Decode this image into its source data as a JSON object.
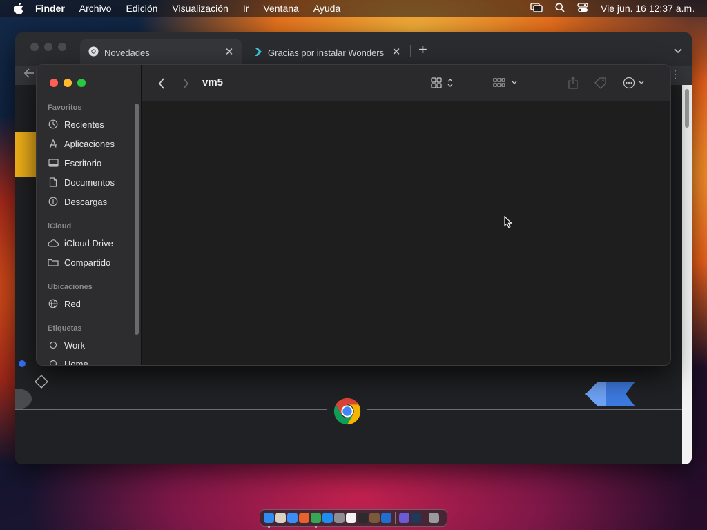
{
  "menubar": {
    "app_name": "Finder",
    "items": [
      "Archivo",
      "Edición",
      "Visualización",
      "Ir",
      "Ventana",
      "Ayuda"
    ],
    "clock": "Vie jun. 16  12:37 a.m."
  },
  "browser": {
    "tabs": [
      {
        "title": "Novedades",
        "icon": "chrome-icon",
        "active": true
      },
      {
        "title": "Gracias por instalar Wondershare",
        "icon": "wondershare-icon",
        "active": false
      }
    ],
    "new_tab_label": "+"
  },
  "finder": {
    "folder_title": "vm5",
    "sidebar": {
      "sections": [
        {
          "title": "Favoritos",
          "items": [
            {
              "label": "Recientes",
              "icon": "clock-icon"
            },
            {
              "label": "Aplicaciones",
              "icon": "applications-icon"
            },
            {
              "label": "Escritorio",
              "icon": "desktop-icon"
            },
            {
              "label": "Documentos",
              "icon": "document-icon"
            },
            {
              "label": "Descargas",
              "icon": "download-icon"
            }
          ]
        },
        {
          "title": "iCloud",
          "items": [
            {
              "label": "iCloud Drive",
              "icon": "cloud-icon"
            },
            {
              "label": "Compartido",
              "icon": "shared-folder-icon"
            }
          ]
        },
        {
          "title": "Ubicaciones",
          "items": [
            {
              "label": "Red",
              "icon": "network-globe-icon"
            }
          ]
        },
        {
          "title": "Etiquetas",
          "items": [
            {
              "label": "Work",
              "icon": "tag-circle-icon"
            },
            {
              "label": "Home",
              "icon": "tag-circle-icon"
            }
          ]
        }
      ]
    }
  },
  "colors": {
    "accent_red": "#ff5f57",
    "accent_yellow": "#febc2e",
    "accent_green": "#28c840"
  }
}
